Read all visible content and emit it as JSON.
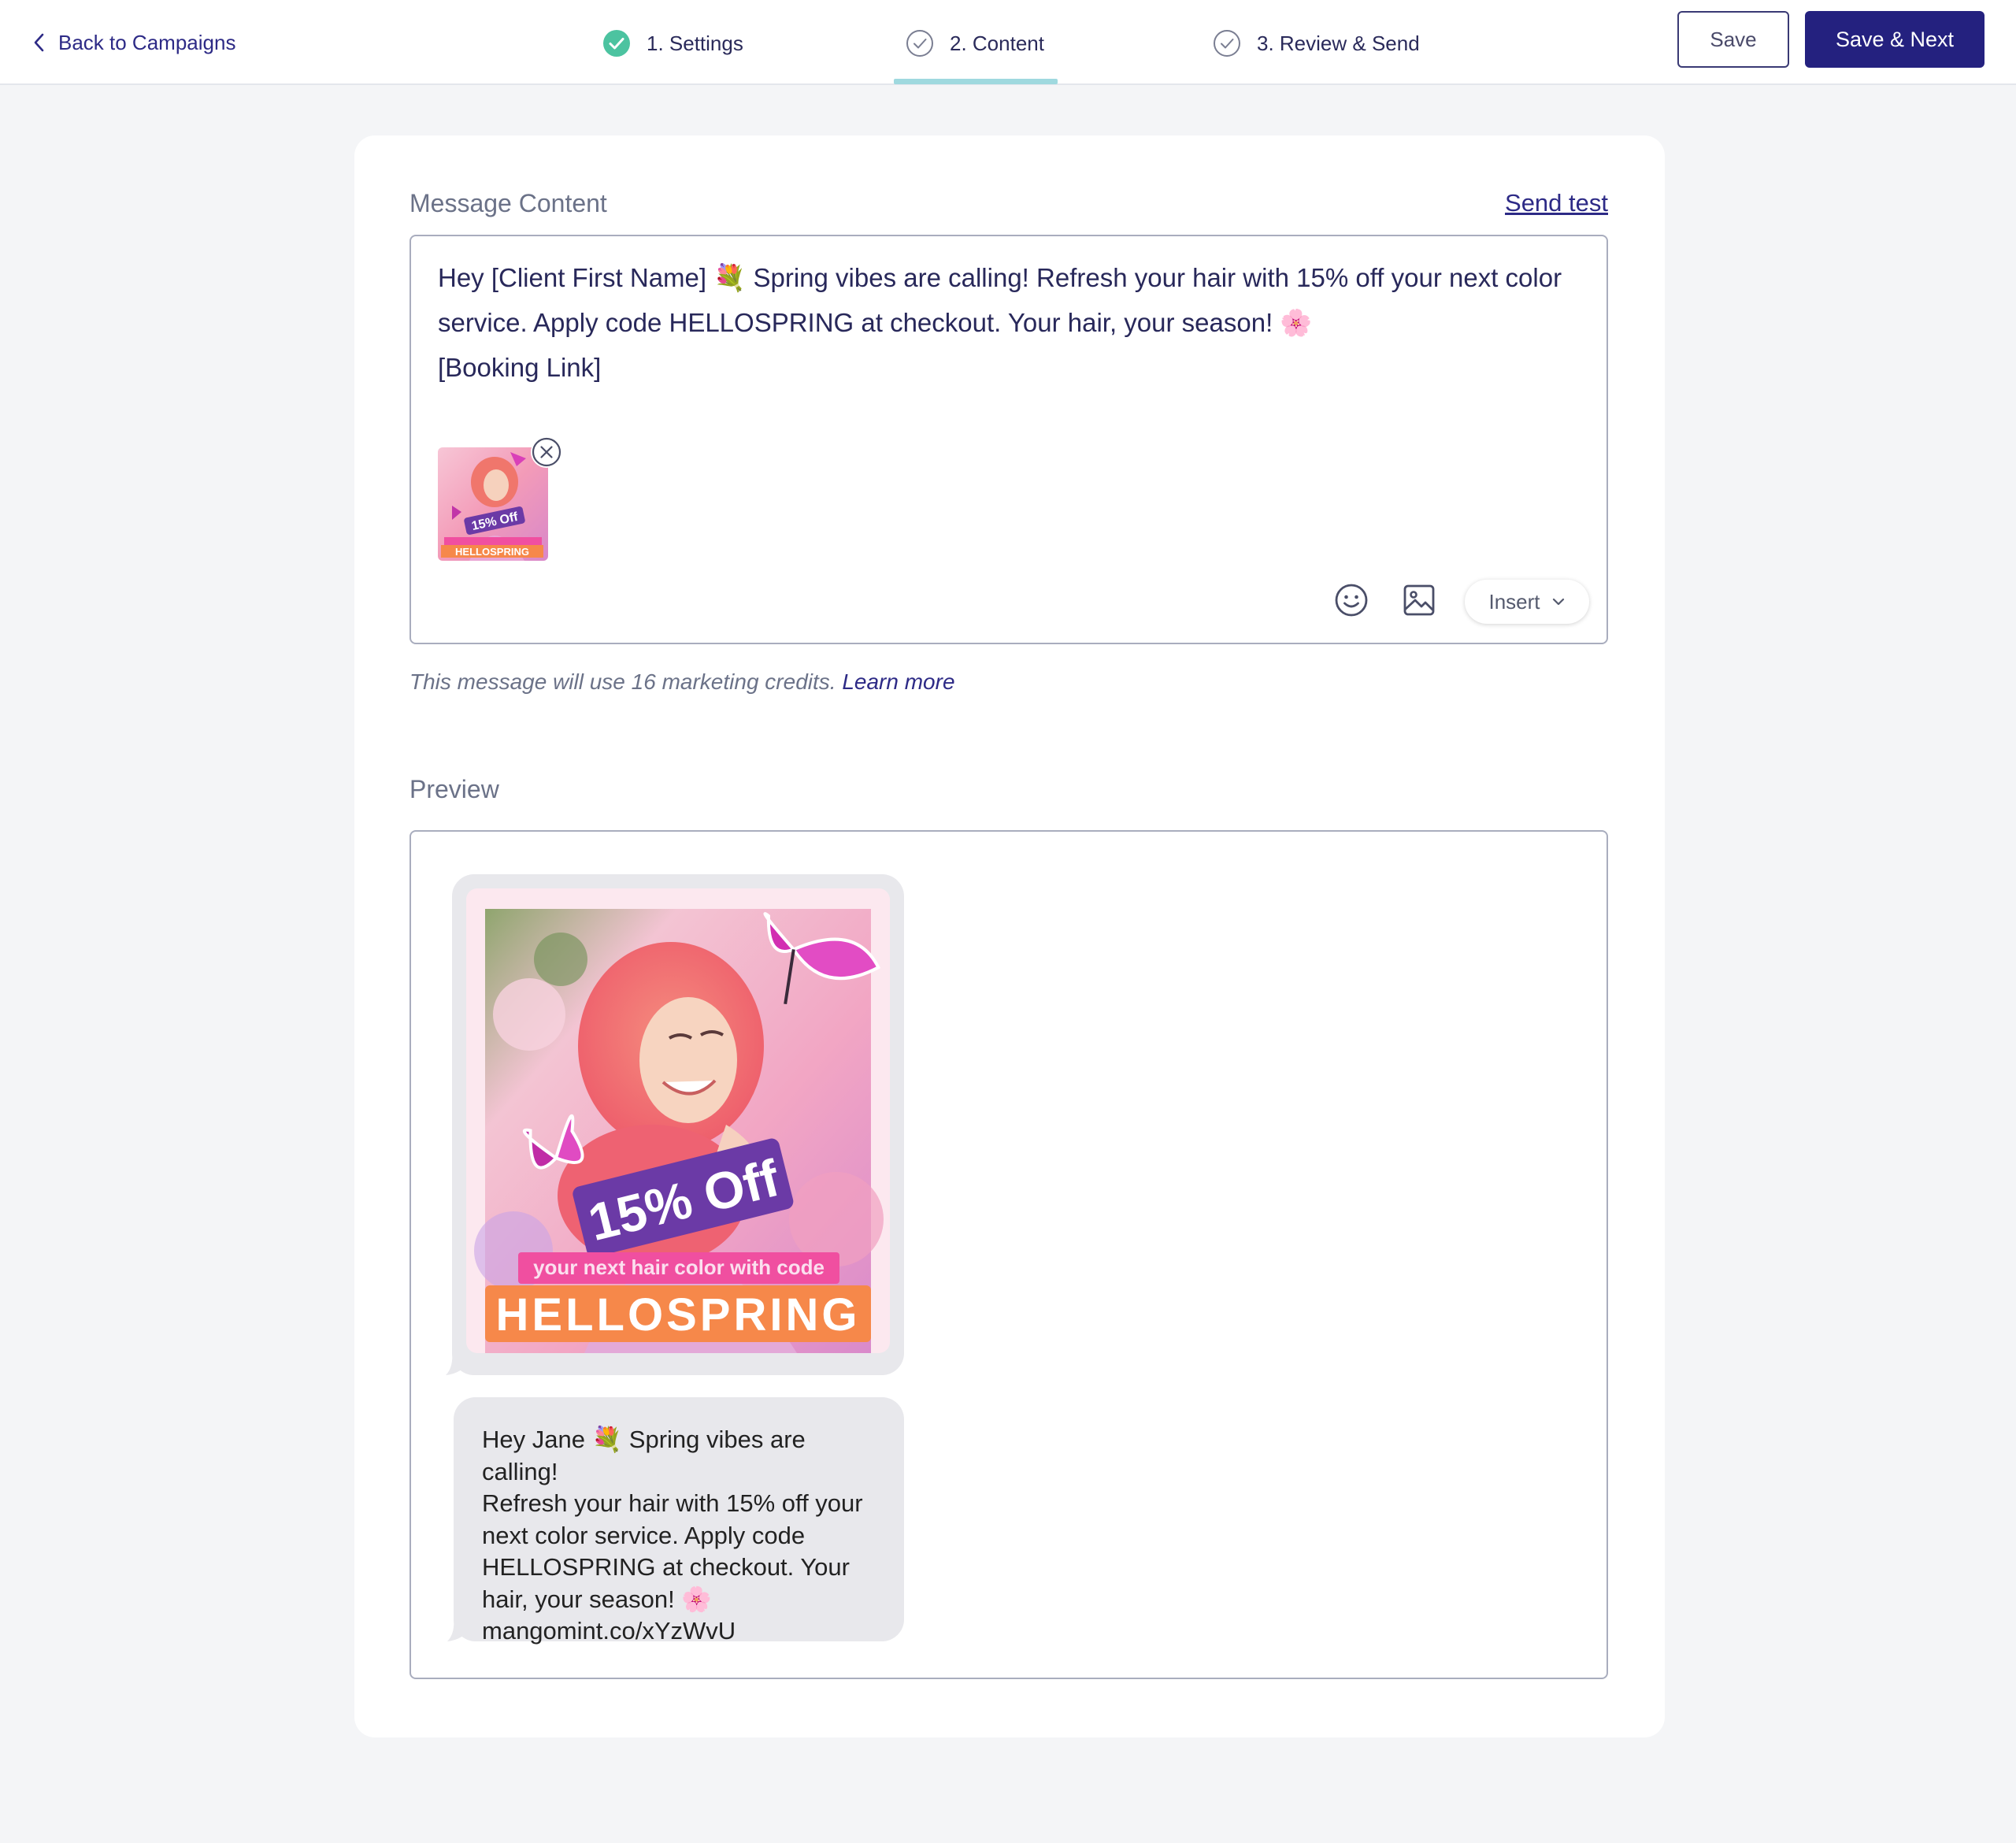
{
  "header": {
    "back_label": "Back to Campaigns",
    "steps": [
      {
        "label": "1. Settings",
        "state": "complete"
      },
      {
        "label": "2. Content",
        "state": "current"
      },
      {
        "label": "3. Review & Send",
        "state": "pending"
      }
    ],
    "save_label": "Save",
    "save_next_label": "Save & Next"
  },
  "content": {
    "section_label": "Message Content",
    "send_test_label": "Send test",
    "message_text": "Hey [Client First Name] 💐 Spring vibes are calling! Refresh your hair with 15% off your next color\nservice. Apply code HELLOSPRING at checkout. Your hair, your season! 🌸\n[Booking Link]",
    "insert_label": "Insert",
    "credits_text": "This message will use 16 marketing credits.",
    "learn_more_label": "Learn more"
  },
  "preview": {
    "section_label": "Preview",
    "promo": {
      "discount": "15% Off",
      "subline": "your next hair color with code",
      "code": "HELLOSPRING"
    },
    "sms_text": "Hey Jane 💐 Spring vibes are calling!\nRefresh your hair with 15% off your\nnext color service. Apply code\nHELLOSPRING at checkout. Your\nhair, your season! 🌸\nmangomint.co/xYzWvU"
  },
  "colors": {
    "brand": "#24217f",
    "step_complete": "#4cc3a0",
    "tab_underline": "#9fd9df",
    "bubble": "#e8e8ec",
    "promo_purple": "#6b3aa6",
    "promo_orange": "#f6884a",
    "promo_pink": "#f04fa0"
  },
  "icons": [
    "chevron-left-icon",
    "check-circle-icon",
    "close-circle-icon",
    "emoji-icon",
    "image-icon",
    "chevron-down-icon"
  ]
}
